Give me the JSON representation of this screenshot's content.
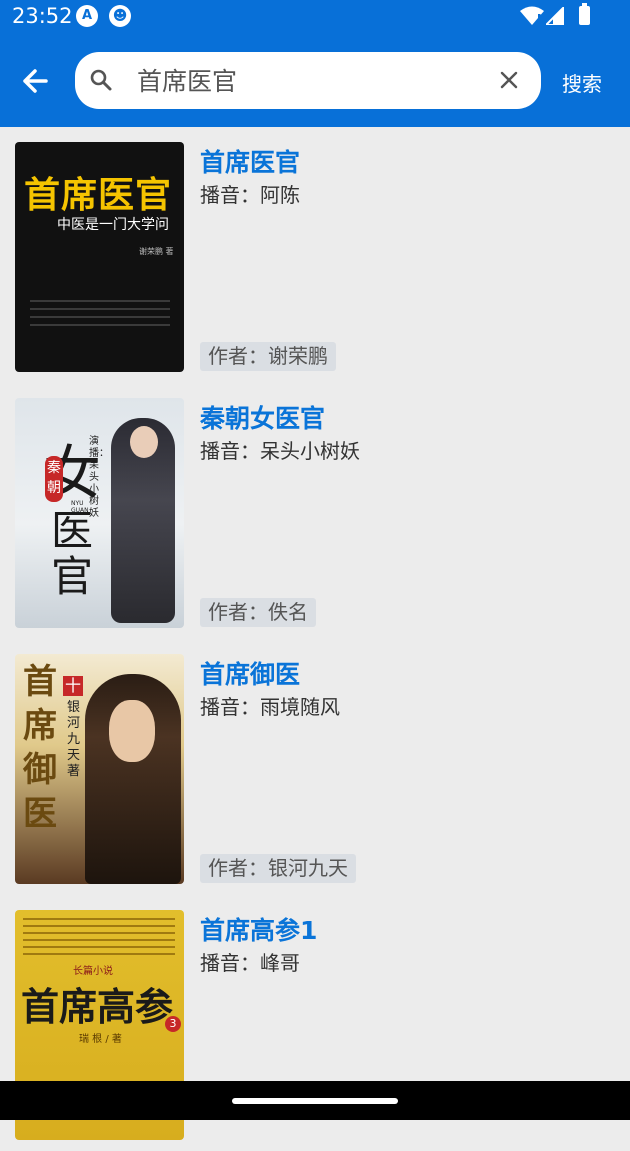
{
  "status_bar": {
    "time": "23:52",
    "icon1": "A",
    "icon2": "☻"
  },
  "header": {
    "search_value": "首席医官",
    "search_button": "搜索"
  },
  "results": [
    {
      "title": "首席医官",
      "narrator": "播音：阿陈",
      "author": "作者：谢荣鹏",
      "cover": {
        "big": "首席医官",
        "sub": "中医是一门大学问",
        "author": "谢荣鹏 著"
      }
    },
    {
      "title": "秦朝女医官",
      "narrator": "播音：呆头小树妖",
      "author": "作者：佚名",
      "cover": {
        "big1": "女",
        "big2": "医官",
        "small": "秦朝",
        "credit": "演播：呆头小树妖",
        "pinyin": "NYU GUAN"
      }
    },
    {
      "title": "首席御医",
      "narrator": "播音：雨境随风",
      "author": "作者：银河九天",
      "cover": {
        "big": "首席御医",
        "author": "银河九天著",
        "badge": "十"
      }
    },
    {
      "title": "首席高参1",
      "narrator": "播音：峰哥",
      "author": "",
      "cover": {
        "big": "首席高参",
        "tag": "长篇小说",
        "author": "瑞 根 / 著",
        "num": "3"
      }
    }
  ],
  "colors": {
    "app_bar": "#0870d8",
    "title": "#0a74d8",
    "background": "#ececec"
  }
}
